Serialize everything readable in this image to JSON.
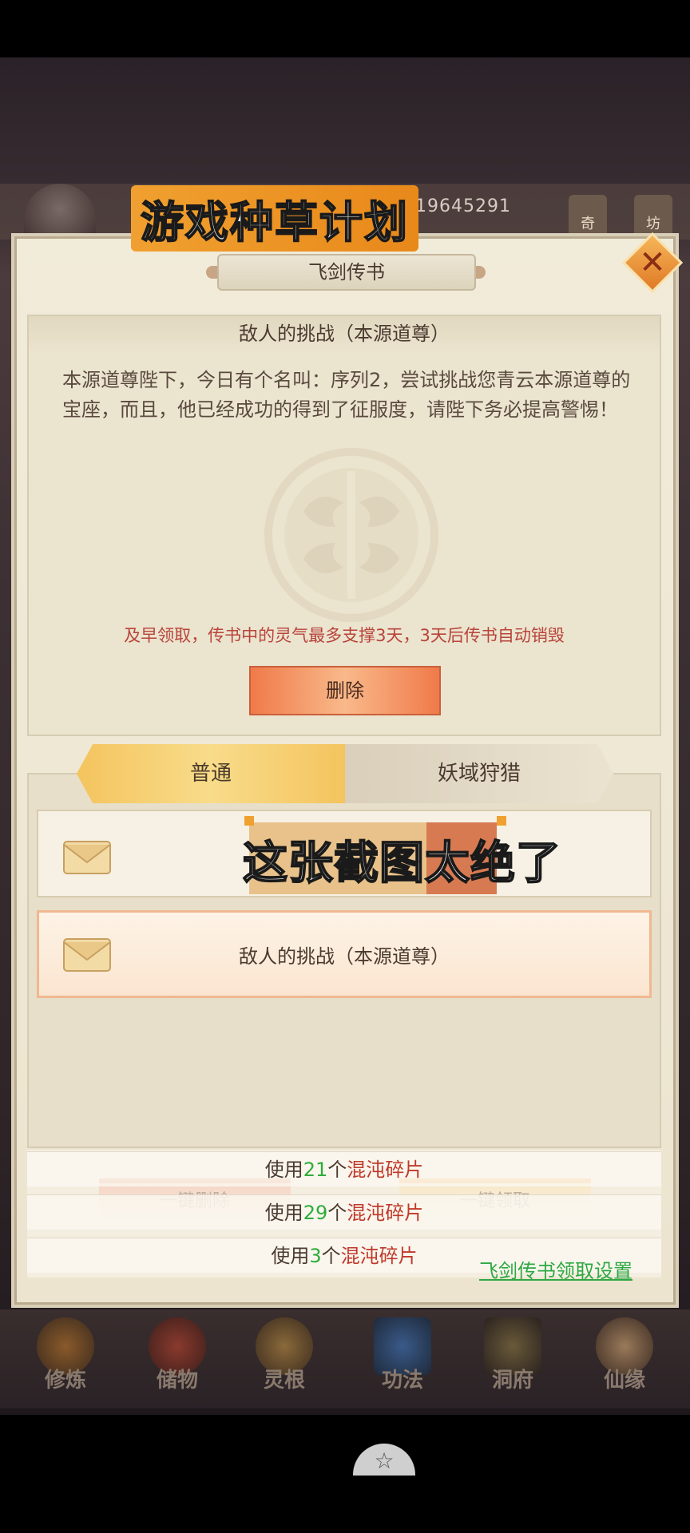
{
  "watermark": {
    "title": "游戏种草计划",
    "caption": "这张截图太绝了"
  },
  "hud": {
    "score": "19645291",
    "icon_1_label": "奇",
    "icon_2_label": "坊"
  },
  "panel": {
    "title": "飞剑传书",
    "close_icon": "close-icon",
    "letter": {
      "title": "敌人的挑战（本源道尊）",
      "body": "本源道尊陛下，今日有个名叫：序列2，尝试挑战您青云本源道尊的宝座，而且，他已经成功的得到了征服度，请陛下务必提高警惕！",
      "warning": "及早领取，传书中的灵气最多支撑3天，3天后传书自动销毁",
      "delete_label": "删除"
    },
    "tabs": [
      {
        "label": "普通",
        "active": true
      },
      {
        "label": "妖域狩猎",
        "active": false
      }
    ],
    "list": [
      {
        "label": ""
      },
      {
        "label": "敌人的挑战（本源道尊）"
      }
    ],
    "actions": {
      "onekey_delete": "一键删除",
      "onekey_claim": "一键领取"
    },
    "use_rows": [
      {
        "prefix": "使用",
        "count": "21",
        "mid": "个",
        "item": "混沌碎片"
      },
      {
        "prefix": "使用",
        "count": "29",
        "mid": "个",
        "item": "混沌碎片"
      },
      {
        "prefix": "使用",
        "count": "3",
        "mid": "个",
        "item": "混沌碎片"
      }
    ],
    "settings_link": "飞剑传书领取设置"
  },
  "bottom_nav": [
    {
      "label": "修炼",
      "icon": "cultivate-icon",
      "color": "#b07a3a"
    },
    {
      "label": "储物",
      "icon": "storage-bag-icon",
      "color": "#9a3a2e"
    },
    {
      "label": "灵根",
      "icon": "spirit-root-icon",
      "color": "#a0723a"
    },
    {
      "label": "功法",
      "icon": "skill-book-icon",
      "color": "#3a5a8a"
    },
    {
      "label": "洞府",
      "icon": "cave-house-icon",
      "color": "#7a5a3a"
    },
    {
      "label": "仙缘",
      "icon": "destiny-icon",
      "color": "#c09060"
    }
  ],
  "system": {
    "home_glyph": "☆"
  }
}
